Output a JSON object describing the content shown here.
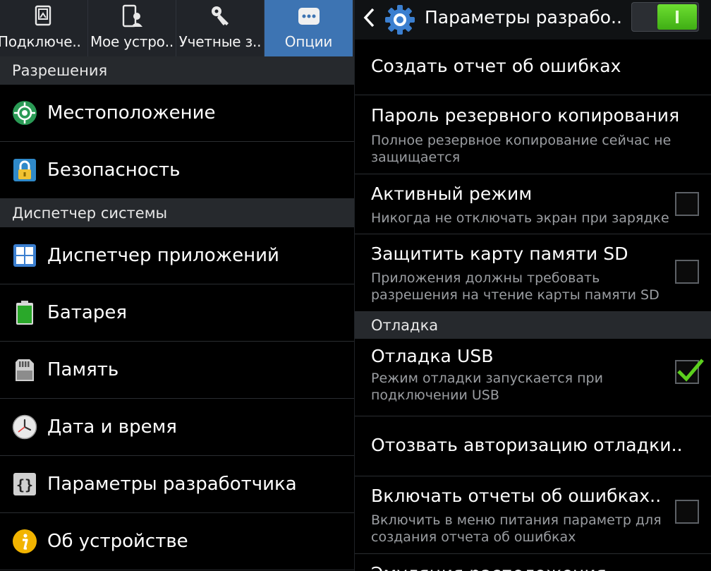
{
  "left": {
    "tabs": [
      {
        "label": "Подключе..",
        "icon": "connections-icon"
      },
      {
        "label": "Мое устро..",
        "icon": "my-device-icon"
      },
      {
        "label": "Учетные з..",
        "icon": "accounts-key-icon"
      },
      {
        "label": "Опции",
        "icon": "more-options-icon",
        "active": true
      }
    ],
    "sections": {
      "permissions": "Разрешения",
      "system_manager": "Диспетчер системы"
    },
    "items": {
      "location": "Местоположение",
      "security": "Безопасность",
      "app_manager": "Диспетчер приложений",
      "battery": "Батарея",
      "storage": "Память",
      "date_time": "Дата и время",
      "developer": "Параметры разработчика",
      "about": "Об устройстве"
    }
  },
  "right": {
    "header": {
      "title": "Параметры разрабо..",
      "master_switch_on": true
    },
    "items": {
      "bugreport": {
        "title": "Создать отчет об ошибках"
      },
      "backup_password": {
        "title": "Пароль резервного копирования",
        "sub1": "Полное резервное копирование сейчас не",
        "sub2": "защищается"
      },
      "stay_awake": {
        "title": "Активный режим",
        "sub1": "Никогда не отключать экран при зарядке",
        "checked": false
      },
      "protect_sd": {
        "title": "Защитить карту памяти SD",
        "sub1": "Приложения должны требовать",
        "sub2": "разрешения на чтение карты памяти SD",
        "checked": false
      },
      "usb_debugging": {
        "title": "Отладка USB",
        "sub1": "Режим отладки запускается при",
        "sub2": "подключении USB",
        "checked": true
      },
      "revoke_auth": {
        "title": "Отозвать авторизацию отладки.."
      },
      "bugreport_power": {
        "title": "Включать отчеты об ошибках..",
        "sub1": "Включить в меню питания параметр для",
        "sub2": "создания отчета об ошибках",
        "checked": false
      },
      "mock_location": {
        "title": "Эмуляция расположения"
      }
    },
    "sections": {
      "debugging": "Отладка"
    }
  },
  "colors": {
    "active_tab": "#3d74b3",
    "section_bg": "#26292d",
    "switch_on": "#4fc21f",
    "check": "#5cd01e"
  }
}
